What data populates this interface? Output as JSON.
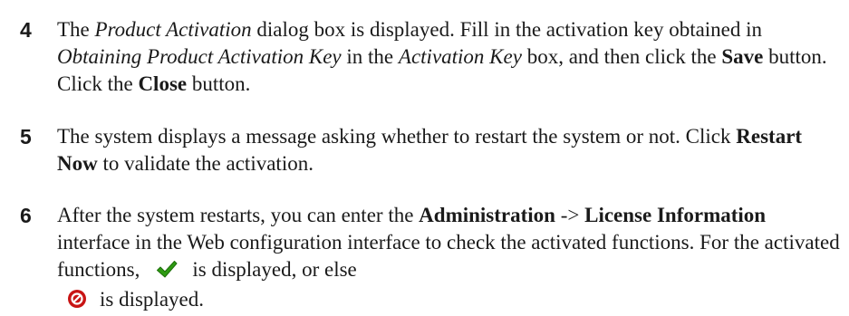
{
  "steps": [
    {
      "number": "4",
      "t1": "The ",
      "t2": "Product Activation",
      "t3": " dialog box is displayed. Fill in the activation key obtained in ",
      "t4": "Obtaining Product Activation Key",
      "t5": " in the ",
      "t6": "Activation Key",
      "t7": " box, and then click the ",
      "t8": "Save",
      "t9": " button. Click the ",
      "t10": "Close",
      "t11": " button."
    },
    {
      "number": "5",
      "t1": "The system displays a message asking whether to restart the system or not. Click ",
      "t2": "Restart Now",
      "t3": " to validate the activation."
    },
    {
      "number": "6",
      "t1": "After the system restarts, you can enter the ",
      "t2": "Administration",
      "t3": " -> ",
      "t4": "License Information",
      "t5": " interface in the Web configuration interface to check the activated functions. For the activated functions,",
      "t6": "is displayed, or else",
      "t7": "is displayed."
    }
  ],
  "icons": {
    "activated": "check-icon",
    "not_activated": "forbidden-icon",
    "check_color": "#2e9b12",
    "forbidden_color": "#c81414"
  }
}
